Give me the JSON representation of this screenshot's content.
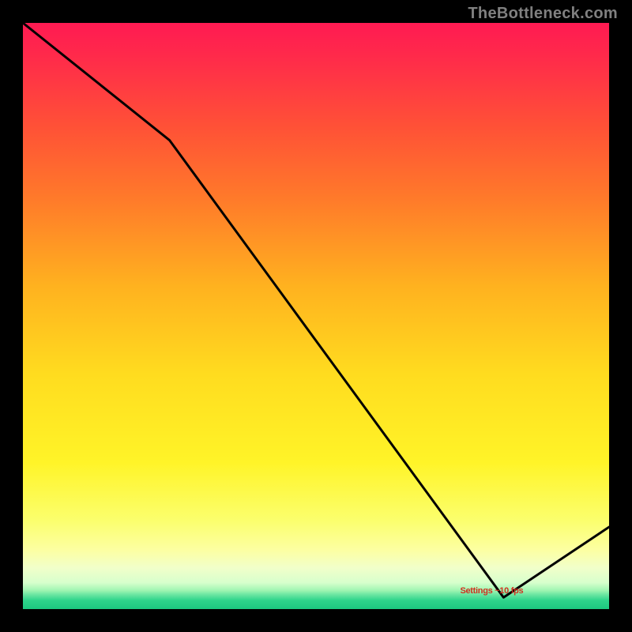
{
  "watermark": "TheBottleneck.com",
  "minimum_label": "Settings ~10 fps",
  "chart_data": {
    "type": "line",
    "title": "",
    "xlabel": "",
    "ylabel": "",
    "x": [
      0.0,
      0.25,
      0.82,
      1.0
    ],
    "values": [
      1.0,
      0.8,
      0.02,
      0.14
    ],
    "xlim": [
      0,
      1
    ],
    "ylim": [
      0,
      1
    ],
    "gradient_stops": [
      {
        "t": 0.0,
        "color": "#ff1a52"
      },
      {
        "t": 0.06,
        "color": "#ff2b4a"
      },
      {
        "t": 0.18,
        "color": "#ff5236"
      },
      {
        "t": 0.3,
        "color": "#ff7a2a"
      },
      {
        "t": 0.45,
        "color": "#ffb21f"
      },
      {
        "t": 0.6,
        "color": "#ffdc1f"
      },
      {
        "t": 0.75,
        "color": "#fff428"
      },
      {
        "t": 0.85,
        "color": "#fbff6e"
      },
      {
        "t": 0.9,
        "color": "#fcffa3"
      },
      {
        "t": 0.93,
        "color": "#f1ffca"
      },
      {
        "t": 0.955,
        "color": "#d7ffcc"
      },
      {
        "t": 0.968,
        "color": "#a0f5b2"
      },
      {
        "t": 0.975,
        "color": "#6de6a2"
      },
      {
        "t": 0.985,
        "color": "#2fd48b"
      },
      {
        "t": 1.0,
        "color": "#1cc87f"
      }
    ],
    "minimum_marker_x": 0.82,
    "minimum_marker_y": 0.02
  }
}
